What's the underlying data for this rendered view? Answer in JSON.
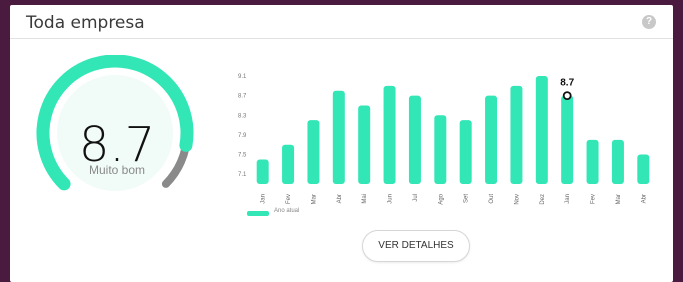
{
  "card": {
    "title": "Toda empresa",
    "help_icon": "help-icon"
  },
  "gauge": {
    "value": "8.7",
    "label": "Muito bom",
    "fraction": 0.87,
    "accent_color": "#32e6b6",
    "track_color": "#8a8a8a"
  },
  "chart_data": {
    "type": "bar",
    "categories": [
      "Jan",
      "Fev",
      "Mar",
      "Abr",
      "Mai",
      "Jun",
      "Jul",
      "Ago",
      "Set",
      "Out",
      "Nov",
      "Dez",
      "Jan",
      "Fev",
      "Mar",
      "Abr"
    ],
    "series": [
      {
        "name": "Ano atual",
        "values": [
          7.4,
          7.7,
          8.2,
          8.8,
          8.5,
          8.9,
          8.7,
          8.3,
          8.2,
          8.7,
          8.9,
          9.1,
          8.7,
          7.8,
          7.8,
          7.5
        ],
        "color": "#32e6b6"
      }
    ],
    "y_ticks": [
      "9.1",
      "8.7",
      "8.3",
      "7.9",
      "7.5",
      "7.1"
    ],
    "ylim": [
      7.1,
      9.1
    ],
    "highlight": {
      "index": 12,
      "label": "8.7"
    },
    "legend_position": "bottom-left",
    "grid": false
  },
  "details_button": {
    "label": "VER DETALHES"
  }
}
